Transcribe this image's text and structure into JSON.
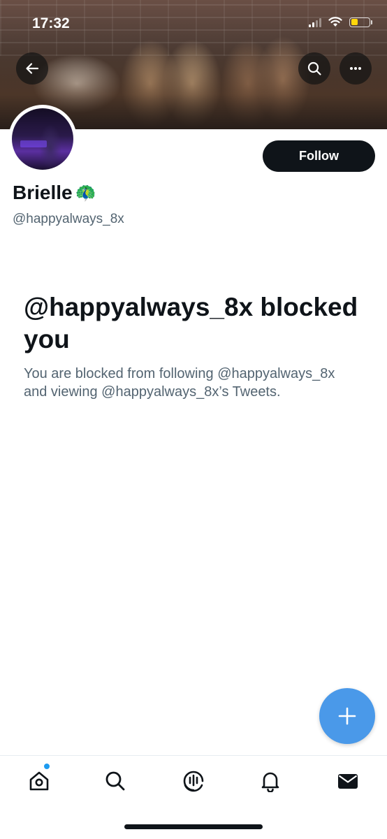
{
  "status_bar": {
    "time": "17:32"
  },
  "profile": {
    "display_name": "Brielle",
    "name_emoji": "🦚",
    "handle": "@happyalways_8x",
    "follow_label": "Follow"
  },
  "blocked": {
    "title": "@happyalways_8x blocked you",
    "description": "You are blocked from following @happyalways_8x and viewing @happyalways_8x’s Tweets."
  },
  "nav": {
    "items": [
      {
        "name": "home",
        "icon": "home-icon",
        "has_badge": true
      },
      {
        "name": "search",
        "icon": "search-icon"
      },
      {
        "name": "spaces",
        "icon": "spaces-icon"
      },
      {
        "name": "notifications",
        "icon": "bell-icon"
      },
      {
        "name": "messages",
        "icon": "envelope-icon"
      }
    ]
  },
  "colors": {
    "accent": "#1d9bf0",
    "fab": "#4a99e9",
    "text_primary": "#0f1419",
    "text_secondary": "#536471",
    "battery": "#ffd60a"
  }
}
